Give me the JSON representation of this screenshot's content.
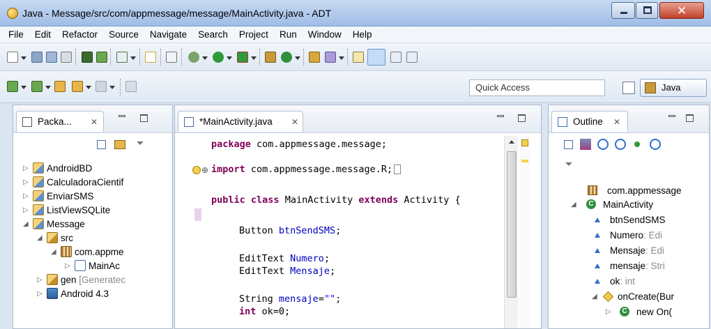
{
  "window": {
    "title": "Java - Message/src/com/appmessage/message/MainActivity.java - ADT"
  },
  "menu": [
    "File",
    "Edit",
    "Refactor",
    "Source",
    "Navigate",
    "Search",
    "Project",
    "Run",
    "Window",
    "Help"
  ],
  "toolbar": {
    "quick_access_placeholder": "Quick Access",
    "perspective_label": "Java"
  },
  "package_explorer": {
    "tab_label": "Packa...",
    "items": [
      {
        "label": "AndroidBD"
      },
      {
        "label": "CalculadoraCientif"
      },
      {
        "label": "EnviarSMS"
      },
      {
        "label": "ListViewSQLite"
      },
      {
        "label": "Message"
      },
      {
        "label": "src"
      },
      {
        "label": "com.appme"
      },
      {
        "label": "MainAc"
      },
      {
        "label": "gen",
        "decoration": "[Generatec"
      },
      {
        "label": "Android 4.3"
      }
    ]
  },
  "editor": {
    "tab_label": "*MainActivity.java",
    "lines": {
      "l1": {
        "kw": "package",
        "rest": " com.appmessage.message;"
      },
      "l2": {
        "kw": "import",
        "rest": " com.appmessage.message.R;"
      },
      "l3": {
        "kw1": "public",
        "kw2": "class",
        "name": " MainActivity ",
        "kw3": "extends",
        "rest": " Activity {"
      },
      "l4": {
        "type": "Button ",
        "field": "btnSendSMS",
        "end": ";"
      },
      "l5": {
        "type": "EditText ",
        "field": "Numero",
        "end": ";"
      },
      "l6": {
        "type": "EditText ",
        "field": "Mensaje",
        "end": ";"
      },
      "l7": {
        "type": "String ",
        "field": "mensaje",
        "eq": "=",
        "str": "\"\"",
        "end": ";"
      },
      "l8": {
        "kw": "int",
        "field": " ok",
        "end": "=0;"
      }
    }
  },
  "outline": {
    "tab_label": "Outline",
    "items": [
      {
        "label": "com.appmessage"
      },
      {
        "label": "MainActivity"
      },
      {
        "label": "btnSendSMS"
      },
      {
        "label": "Numero",
        "type": " : Edi"
      },
      {
        "label": "Mensaje",
        "type": " : Edi"
      },
      {
        "label": "mensaje",
        "type": " : Stri"
      },
      {
        "label": "ok",
        "type": " : int"
      },
      {
        "label": "onCreate(Bur"
      },
      {
        "label": "new On("
      }
    ]
  },
  "colors": {
    "keyword": "#7f0055",
    "field": "#0000c0",
    "string": "#2a00ff"
  }
}
